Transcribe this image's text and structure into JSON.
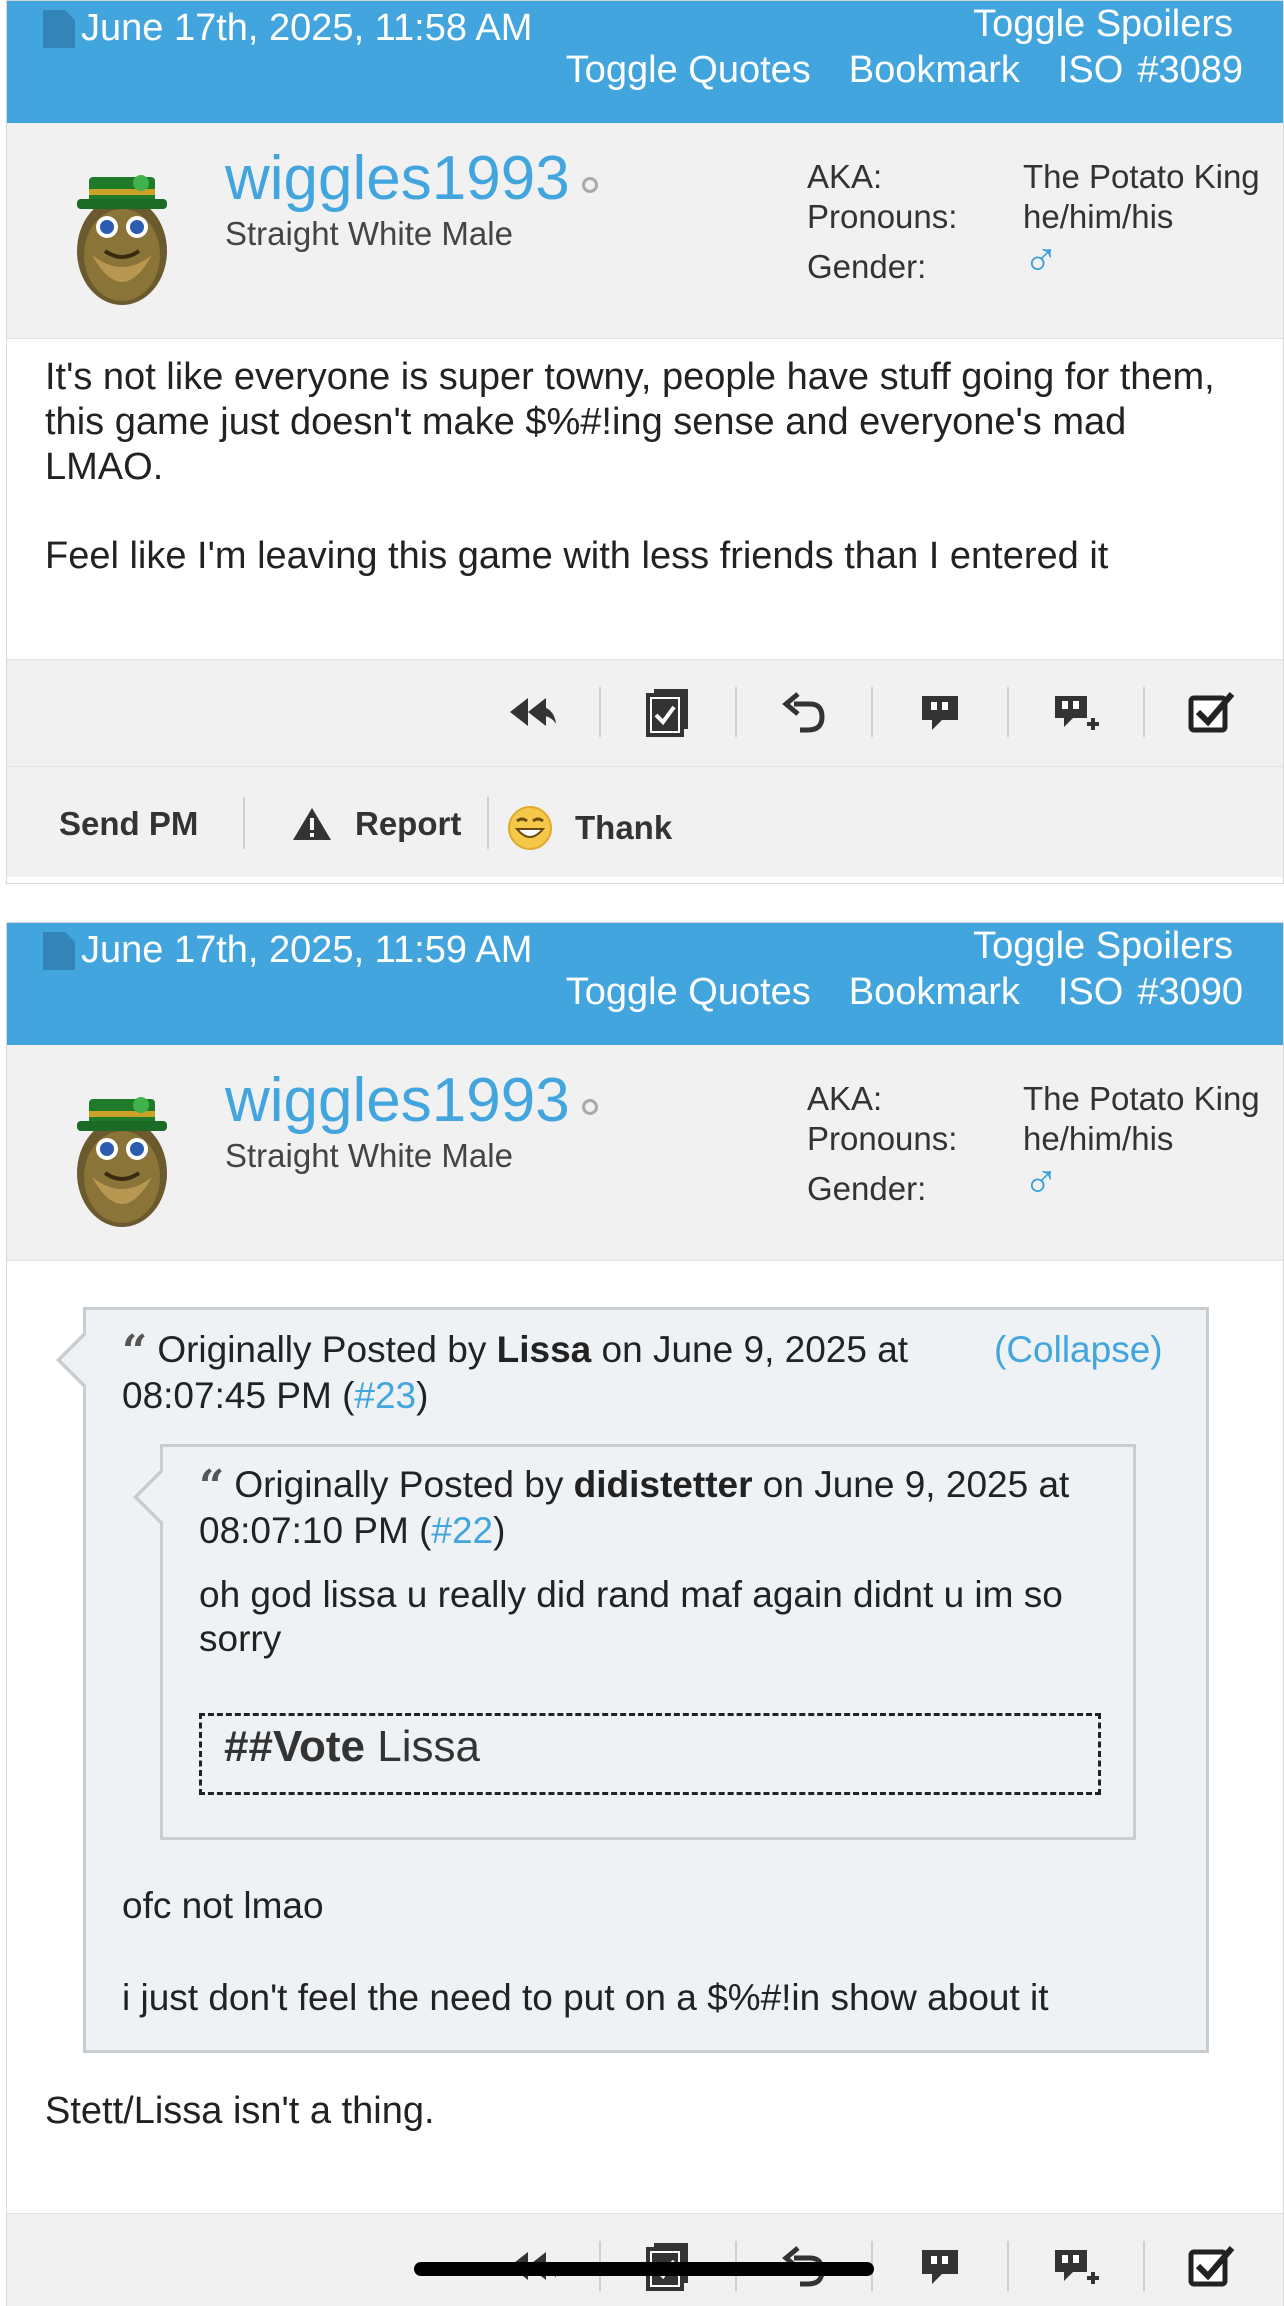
{
  "posts": [
    {
      "header": {
        "date": "June 17th, 2025, 11:58 AM",
        "toggle_spoilers": "Toggle Spoilers",
        "toggle_quotes": "Toggle Quotes",
        "bookmark": "Bookmark",
        "iso": "ISO",
        "post_number": "#3089"
      },
      "user": {
        "username": "wiggles1993",
        "title": "Straight White Male",
        "aka_label": "AKA:",
        "aka_value": "The Potato King",
        "pronouns_label": "Pronouns:",
        "pronouns_value": "he/him/his",
        "gender_label": "Gender:",
        "gender_value": "♂"
      },
      "body": {
        "p1": "It's not like everyone is super towny, people have stuff going for them, this game just doesn't make $%#!ing sense and everyone's mad LMAO.",
        "p2": "Feel like I'm leaving this game with less friends than I entered it"
      },
      "footer": {
        "send_pm": "Send PM",
        "report": "Report",
        "thank": "Thank"
      }
    },
    {
      "header": {
        "date": "June 17th, 2025, 11:59 AM",
        "toggle_spoilers": "Toggle Spoilers",
        "toggle_quotes": "Toggle Quotes",
        "bookmark": "Bookmark",
        "iso": "ISO",
        "post_number": "#3090"
      },
      "user": {
        "username": "wiggles1993",
        "title": "Straight White Male",
        "aka_label": "AKA:",
        "aka_value": "The Potato King",
        "pronouns_label": "Pronouns:",
        "pronouns_value": "he/him/his",
        "gender_label": "Gender:",
        "gender_value": "♂"
      },
      "outer_quote": {
        "prefix": "Originally Posted by",
        "author": "Lissa",
        "on_text": "on June 9, 2025 at",
        "time_text": "08:07:45 PM (",
        "post_link": "#23",
        "close_paren": ")",
        "collapse": "(Collapse)",
        "body1": "ofc not lmao",
        "body2": "i just don't feel the need to put on a $%#!in show about it"
      },
      "inner_quote": {
        "prefix": "Originally Posted by",
        "author": "didistetter",
        "on_text": "on June 9, 2025 at 08:07:10 PM (",
        "post_link": "#22",
        "close_paren": ")",
        "body": "oh god lissa u really did rand maf again didnt u im so sorry",
        "vote_label": "##Vote",
        "vote_target": "Lissa"
      },
      "body": {
        "p1": "Stett/Lissa isn't a thing."
      }
    }
  ]
}
